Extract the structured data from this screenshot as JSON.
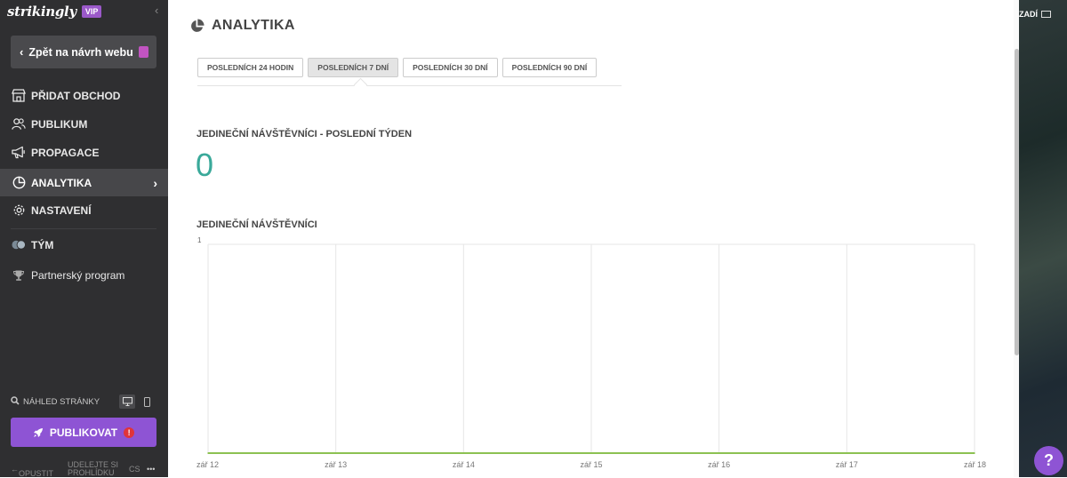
{
  "sidebar": {
    "logo": "strikingly",
    "vip": "VIP",
    "back_label": "Zpět na návrh webu",
    "items": [
      {
        "label": "PŘIDAT OBCHOD"
      },
      {
        "label": "PUBLIKUM"
      },
      {
        "label": "PROPAGACE"
      },
      {
        "label": "ANALYTIKA"
      },
      {
        "label": "NASTAVENÍ"
      },
      {
        "label": "TÝM"
      },
      {
        "label": "Partnerský program"
      }
    ],
    "preview_label": "NÁHLED STRÁNKY",
    "publish_label": "PUBLIKOVAT",
    "publish_warning": "!",
    "footer": {
      "exit": "OPUSTIT",
      "tell": "UDĚLEJTE SI PROHLÍDKU",
      "lang": "CS",
      "more": "•••"
    }
  },
  "main": {
    "title": "ANALYTIKA",
    "tabs": [
      {
        "label": "POSLEDNÍCH 24 HODIN"
      },
      {
        "label": "POSLEDNÍCH 7 DNÍ"
      },
      {
        "label": "POSLEDNÍCH 30 DNÍ"
      },
      {
        "label": "POSLEDNÍCH 90 DNÍ"
      }
    ],
    "active_tab": 1,
    "metric_label": "JEDINEČNÍ NÁVŠTĚVNÍCI - POSLEDNÍ TÝDEN",
    "metric_value": "0",
    "chart_label": "JEDINEČNÍ NÁVŠTĚVNÍCI"
  },
  "background_label": "ZADÍ",
  "help_label": "?",
  "colors": {
    "sidebar_bg": "#2f2f31",
    "accent_purple": "#8e54d4",
    "metric_teal": "#3aa99a",
    "series_green": "#8cc152"
  },
  "chart_data": {
    "type": "line",
    "x": [
      "zář 12",
      "zář 13",
      "zář 14",
      "zář 15",
      "zář 16",
      "zář 17",
      "zář 18"
    ],
    "series": [
      {
        "values": [
          0,
          0,
          0,
          0,
          0,
          0,
          0
        ]
      }
    ],
    "y_tick_labels": [
      "1"
    ],
    "ylim": [
      0,
      1
    ],
    "grid": true
  }
}
